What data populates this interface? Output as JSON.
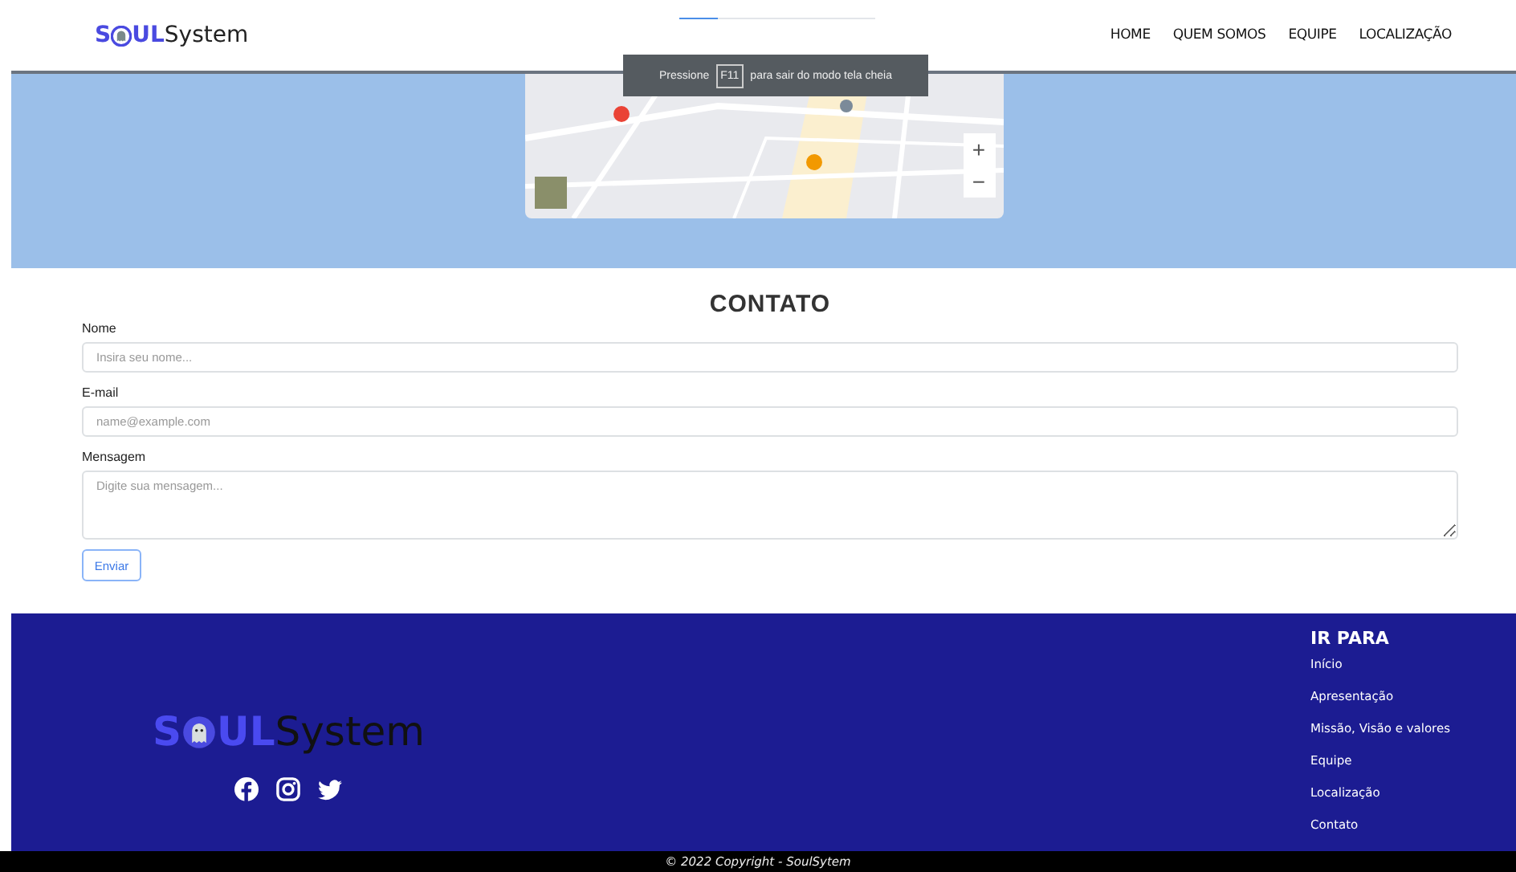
{
  "loading_bar": {
    "level": 0.2
  },
  "header": {
    "logo": {
      "prefix": "S",
      "suffix": "UL",
      "name": "System"
    },
    "nav": [
      {
        "label": "HOME"
      },
      {
        "label": "QUEM SOMOS"
      },
      {
        "label": "EQUIPE"
      },
      {
        "label": "LOCALIZAÇÃO"
      }
    ]
  },
  "fullscreen_notice": {
    "before": "Pressione",
    "key": "F11",
    "after": "para sair do modo tela cheia"
  },
  "map": {
    "kind": "picture",
    "zoom_in": "+",
    "zoom_out": "−"
  },
  "contact": {
    "title": "CONTATO",
    "fields": [
      {
        "kind": "input",
        "label": "Nome",
        "placeholder": "Insira seu nome..."
      },
      {
        "kind": "input",
        "label": "E-mail",
        "placeholder": "name@example.com"
      },
      {
        "kind": "textarea",
        "label": "Mensagem",
        "placeholder": "Digite sua mensagem..."
      }
    ],
    "submit": "Enviar"
  },
  "footer": {
    "logo": {
      "prefix": "S",
      "suffix": "UL",
      "name": "System"
    },
    "heading": "IR PARA",
    "links": [
      "Início",
      "Apresentação",
      "Missão, Visão e valores",
      "Equipe",
      "Localização",
      "Contato"
    ],
    "copyright": "© 2022 Copyright - SoulSytem"
  }
}
